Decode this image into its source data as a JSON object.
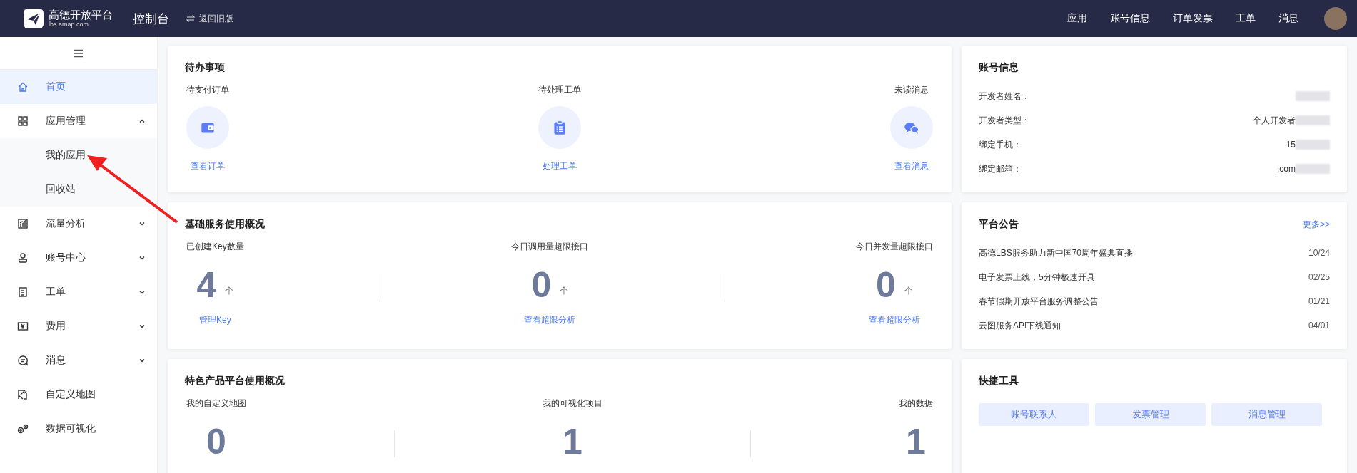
{
  "header": {
    "logo_name": "高德开放平台",
    "logo_domain": "lbs.amap.com",
    "title": "控制台",
    "switch_link": "返回旧版",
    "nav": [
      "应用",
      "账号信息",
      "订单发票",
      "工单",
      "消息"
    ]
  },
  "sidebar": {
    "items": [
      {
        "label": "首页",
        "selected": true
      },
      {
        "label": "应用管理",
        "selected": false,
        "expanded": true,
        "children": [
          {
            "label": "我的应用",
            "selected": false
          },
          {
            "label": "回收站",
            "selected": false
          }
        ]
      },
      {
        "label": "流量分析",
        "selected": false,
        "expanded": false
      },
      {
        "label": "账号中心",
        "selected": false,
        "expanded": false
      },
      {
        "label": "工单",
        "selected": false,
        "expanded": false
      },
      {
        "label": "费用",
        "selected": false,
        "expanded": false
      },
      {
        "label": "消息",
        "selected": false,
        "expanded": false
      },
      {
        "label": "自定义地图",
        "selected": false
      },
      {
        "label": "数据可视化",
        "selected": false
      }
    ]
  },
  "todo": {
    "title": "待办事项",
    "items": [
      {
        "label": "待支付订单",
        "link": "查看订单"
      },
      {
        "label": "待处理工单",
        "link": "处理工单"
      },
      {
        "label": "未读消息",
        "link": "查看消息"
      }
    ]
  },
  "basic_usage": {
    "title": "基础服务使用概况",
    "stats": [
      {
        "label": "已创建Key数量",
        "value": "4",
        "unit": "个",
        "link": "管理Key"
      },
      {
        "label": "今日调用量超限接口",
        "value": "0",
        "unit": "个",
        "link": "查看超限分析"
      },
      {
        "label": "今日并发量超限接口",
        "value": "0",
        "unit": "个",
        "link": "查看超限分析"
      }
    ]
  },
  "featured_usage": {
    "title": "特色产品平台使用概况",
    "stats": [
      {
        "label": "我的自定义地图",
        "value": "0"
      },
      {
        "label": "我的可视化项目",
        "value": "1"
      },
      {
        "label": "我的数据",
        "value": "1"
      }
    ]
  },
  "account": {
    "title": "账号信息",
    "rows": [
      {
        "label": "开发者姓名：",
        "value": ""
      },
      {
        "label": "开发者类型：",
        "value": "个人开发者"
      },
      {
        "label": "绑定手机：",
        "value": "15"
      },
      {
        "label": "绑定邮箱：",
        "value": ".com"
      }
    ]
  },
  "notices": {
    "title": "平台公告",
    "more": "更多>>",
    "items": [
      {
        "text": "高德LBS服务助力新中国70周年盛典直播",
        "date": "10/24"
      },
      {
        "text": "电子发票上线，5分钟极速开具",
        "date": "02/25"
      },
      {
        "text": "春节假期开放平台服务调整公告",
        "date": "01/21"
      },
      {
        "text": "云图服务API下线通知",
        "date": "04/01"
      }
    ]
  },
  "tools": {
    "title": "快捷工具",
    "buttons": [
      "账号联系人",
      "发票管理",
      "消息管理"
    ]
  }
}
